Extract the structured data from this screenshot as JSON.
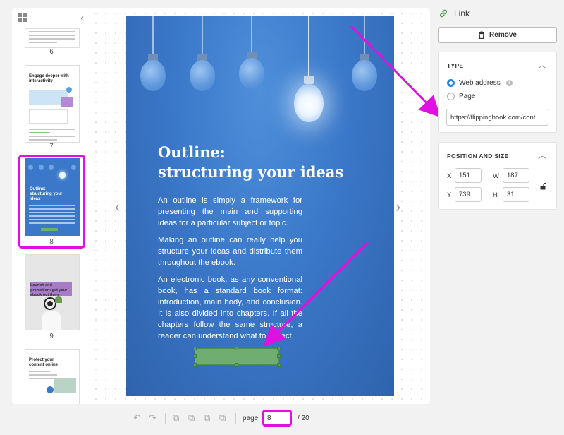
{
  "sidebar": {
    "thumbnails": [
      {
        "number": "6"
      },
      {
        "number": "7",
        "heading": "Engage deeper with interactivity"
      },
      {
        "number": "8",
        "heading": "Outline: structuring your ideas"
      },
      {
        "number": "9",
        "heading": "Launch and promotion: get your ebook out there"
      },
      {
        "number": "",
        "heading": "Protect your content online"
      }
    ]
  },
  "page": {
    "title_line1": "Outline:",
    "title_line2": "structuring your ideas",
    "paragraphs": [
      "An outline is simply a framework for presenting the main and supporting ideas for a particular subject or topic.",
      "Making an outline can really help you structure your ideas and distribute them throughout the ebook.",
      "An electronic book, as any conventional book, has a standard book format: introduction, main body, and conclusion. It is also divided into chapters. If all the chapters follow the same structure, a reader can understand what to expect."
    ]
  },
  "panel": {
    "title": "Link",
    "remove_label": "Remove",
    "type_section": {
      "heading": "TYPE",
      "option_web": "Web address",
      "option_page": "Page",
      "url_value": "https://flippingbook.com/cont"
    },
    "position_section": {
      "heading": "POSITION AND SIZE",
      "x_label": "X",
      "x_value": "151",
      "w_label": "W",
      "w_value": "187",
      "y_label": "Y",
      "y_value": "739",
      "h_label": "H",
      "h_value": "31"
    }
  },
  "toolbar": {
    "page_label": "page",
    "page_value": "8",
    "page_total": "/ 20"
  },
  "colors": {
    "accent": "#2b84d9",
    "highlight": "#e010e0",
    "link_area": "#6fae70"
  }
}
